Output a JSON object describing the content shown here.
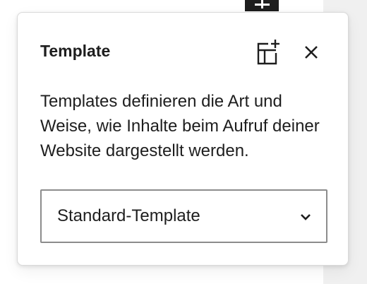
{
  "popover": {
    "title": "Template",
    "description": "Templates definieren die Art und Weise, wie Inhalte beim Aufruf deiner Website dargestellt werden.",
    "add_template_icon": "add-template-icon",
    "close_icon": "close-icon"
  },
  "template_select": {
    "selected": "Standard-Template",
    "chevron_icon": "chevron-down-icon"
  },
  "toolbar": {
    "add_block_icon": "plus-icon"
  },
  "colors": {
    "text": "#1e1e1e",
    "border": "#8c8c8c",
    "sidebar_strip": "#f0f0f0",
    "toolbar_button": "#1e1e1e"
  }
}
